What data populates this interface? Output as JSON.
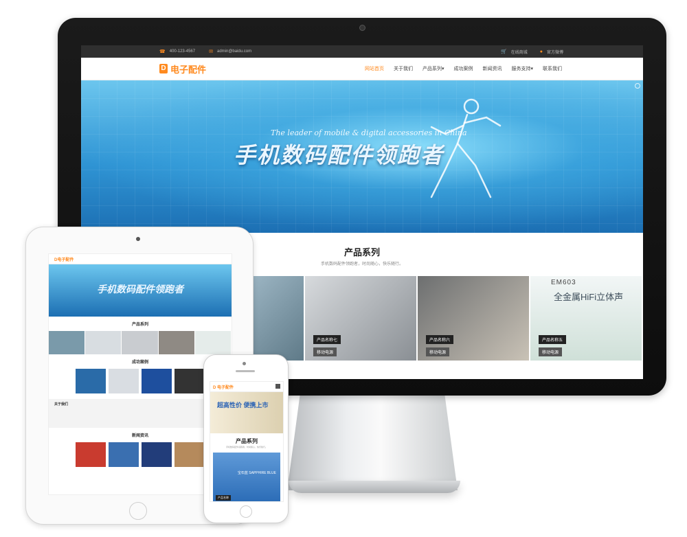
{
  "monitor": {
    "topbar": {
      "phone": "400-123-4567",
      "email": "admin@baidu.com",
      "shop": "在线商城",
      "weibo": "官方微博"
    },
    "nav": {
      "logo_mark": "D",
      "logo_text": "电子配件",
      "menu": [
        "网站首页",
        "关于我们",
        "产品系列▾",
        "成功案例",
        "新闻资讯",
        "服务支持▾",
        "联系我们"
      ]
    },
    "hero": {
      "subtitle": "The leader of mobile & digital accessories in China",
      "headline": "手机数码配件领跑者"
    },
    "products": {
      "title": "产品系列",
      "subtitle": "手机数码配件领跑者，时尚随心，快乐随行。",
      "cards": [
        {
          "name": "",
          "tag": ""
        },
        {
          "name": "产品名称七",
          "tag": "移动电源"
        },
        {
          "name": "产品名称六",
          "tag": "移动电源"
        },
        {
          "name": "产品名称五",
          "tag": "移动电源",
          "overlay1": "EM603",
          "overlay2": "全金属HiFi立体声"
        }
      ]
    }
  },
  "tablet": {
    "logo": "D电子配件",
    "headline": "手机数码配件领跑者",
    "section1": "产品系列",
    "section2": "成功案例",
    "section3": "新闻资讯",
    "about": "关于我们"
  },
  "phone": {
    "logo": "D 电子配件",
    "banner": "超高性价 便携上市",
    "title": "产品系列",
    "subtitle": "手机数码配件领跑者，时尚随心，快乐随行。",
    "img_text": "宝石蓝 SAPPHIRE BLUE",
    "caption": "产品名称"
  }
}
